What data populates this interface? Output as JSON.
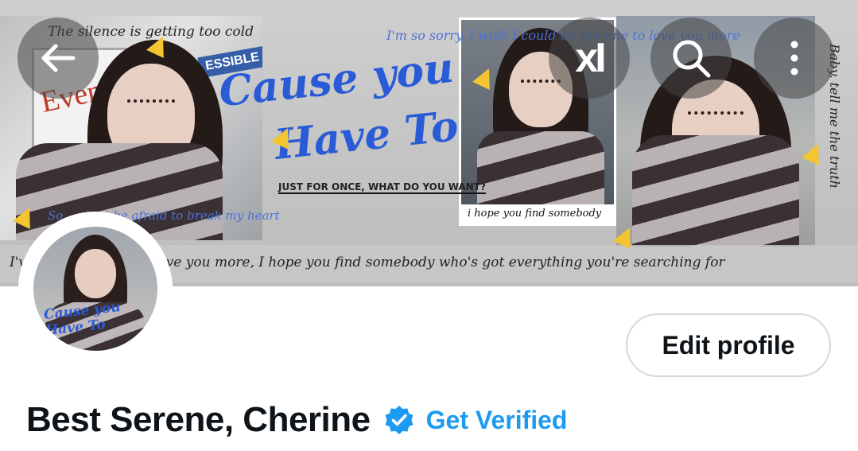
{
  "header": {
    "back_icon": "arrow-left-icon",
    "grok_icon": "grok-logo-icon",
    "search_icon": "search-icon",
    "more_icon": "more-vertical-icon",
    "grok_label": "xI"
  },
  "banner": {
    "top_left_text": "The silence is getting too cold",
    "top_right_text": "I'm so sorry, I wish I could be the one to love you more",
    "title_line1": "Cause you",
    "title_line2": "Have To",
    "subtitle": "JUST FOR ONCE, WHAT DO YOU WANT?",
    "left_blue_text": "So ... dont be afraid to break my heart",
    "photo_caption": "i hope you find somebody",
    "vertical_text": "Baby, tell me the truth",
    "bottom_strip": "I'v... ld be the one to love you more, I hope you find somebody who's got everything you're searching for",
    "sign_text": "Event Park",
    "blue_sign_text": "ESSIBLE"
  },
  "profile": {
    "edit_label": "Edit profile",
    "display_name": "Best Serene, Cherine",
    "verified_badge_icon": "verified-badge-icon",
    "get_verified_label": "Get Verified",
    "colors": {
      "accent": "#1d9bf0",
      "badge": "#1d9bf0",
      "text": "#0f1419",
      "border": "#cfd9de"
    }
  }
}
